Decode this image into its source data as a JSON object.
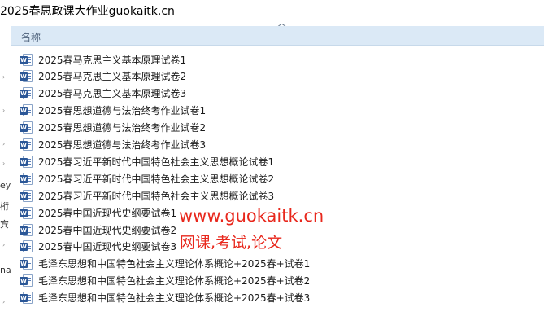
{
  "window": {
    "title": "2025春思政课大作业guokaitk.cn"
  },
  "nav_pane": {
    "fragments": [
      "ey",
      "桁",
      "宾",
      "na"
    ]
  },
  "file_list": {
    "column_name": "名称",
    "file_icon": "word-document-icon",
    "items": [
      "2025春马克思主义基本原理试卷1",
      "2025春马克思主义基本原理试卷2",
      "2025春马克思主义基本原理试卷3",
      "2025春思想道德与法治终考作业试卷1",
      "2025春思想道德与法治终考作业试卷2",
      "2025春思想道德与法治终考作业试卷3",
      "2025春习近平新时代中国特色社会主义思想概论试卷1",
      "2025春习近平新时代中国特色社会主义思想概论试卷2",
      "2025春习近平新时代中国特色社会主义思想概论试卷3",
      "2025春中国近现代史纲要试卷1",
      "2025春中国近现代史纲要试卷2",
      "2025春中国近现代史纲要试卷3",
      "毛泽东思想和中国特色社会主义理论体系概论+2025春+试卷1",
      "毛泽东思想和中国特色社会主义理论体系概论+2025春+试卷2",
      "毛泽东思想和中国特色社会主义理论体系概论+2025春+试卷3"
    ]
  },
  "watermark": {
    "url": "www.guokaitk.cn",
    "subtitle": "网课,考试,论文",
    "color": "#e8271c"
  }
}
